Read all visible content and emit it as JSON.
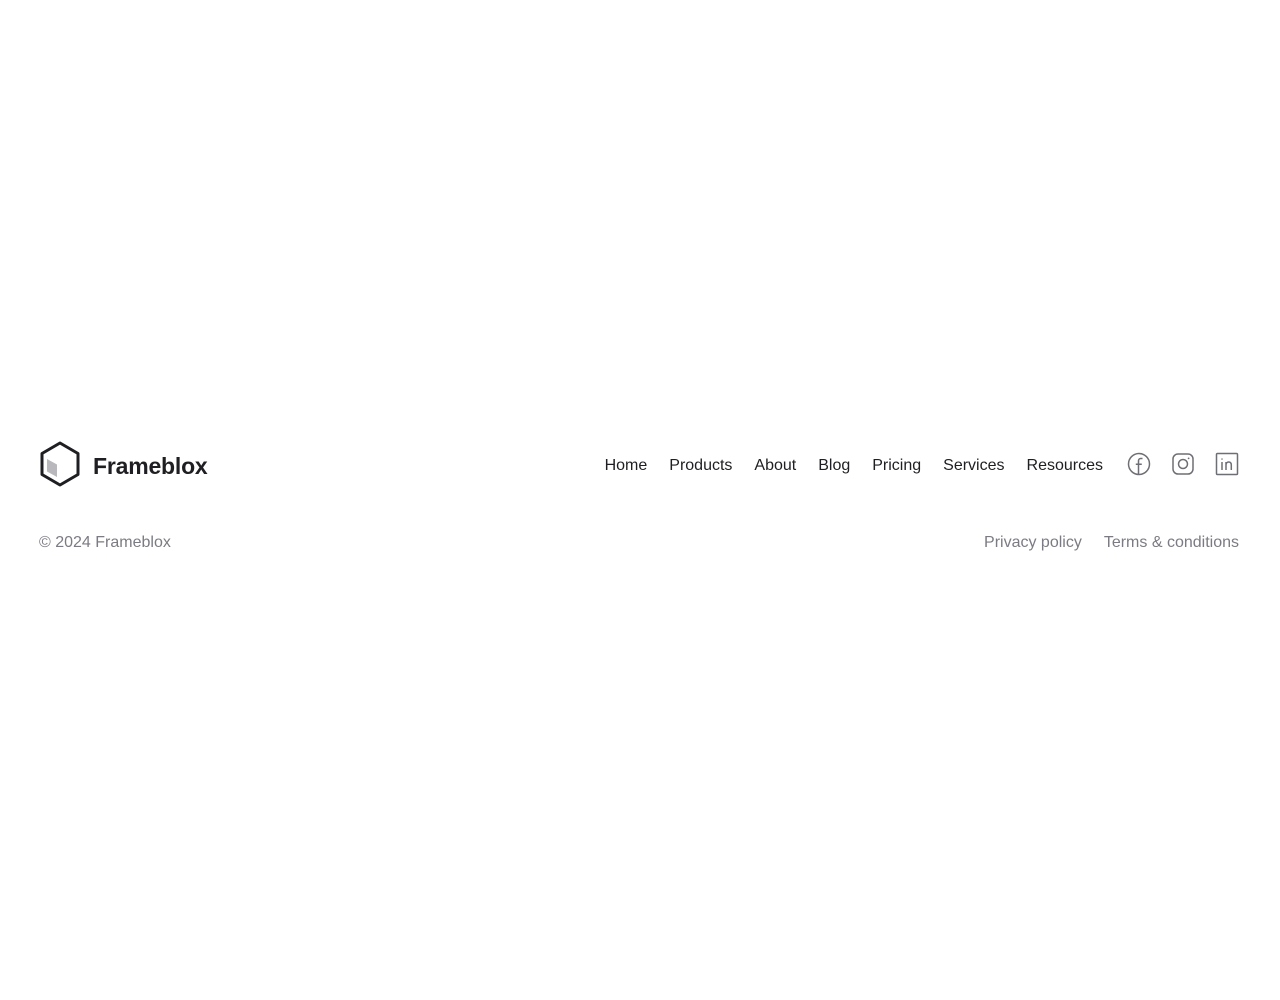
{
  "footer": {
    "brand": {
      "name": "Frameblox",
      "logo_icon": "hexagon-cube-icon"
    },
    "nav": [
      {
        "label": "Home"
      },
      {
        "label": "Products"
      },
      {
        "label": "About"
      },
      {
        "label": "Blog"
      },
      {
        "label": "Pricing"
      },
      {
        "label": "Services"
      },
      {
        "label": "Resources"
      }
    ],
    "social": [
      {
        "name": "facebook",
        "icon": "facebook-icon"
      },
      {
        "name": "instagram",
        "icon": "instagram-icon"
      },
      {
        "name": "linkedin",
        "icon": "linkedin-icon"
      }
    ],
    "copyright": "© 2024 Frameblox",
    "legal": [
      {
        "label": "Privacy policy"
      },
      {
        "label": "Terms & conditions"
      }
    ],
    "colors": {
      "text_primary": "#1f1f23",
      "text_muted": "#7b7b83",
      "icon": "#6e6e75"
    }
  }
}
